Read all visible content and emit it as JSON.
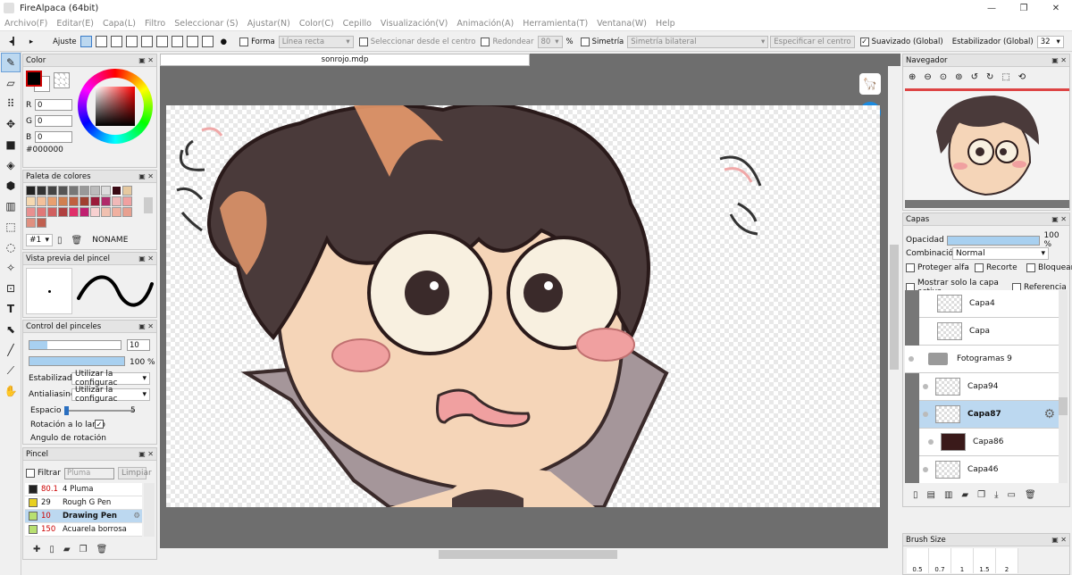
{
  "window": {
    "title": "FireAlpaca (64bit)"
  },
  "menu": [
    "Archivo(F)",
    "Editar(E)",
    "Capa(L)",
    "Filtro",
    "Seleccionar (S)",
    "Ajustar(N)",
    "Color(C)",
    "Cepillo",
    "Visualización(V)",
    "Animación(A)",
    "Herramienta(T)",
    "Ventana(W)",
    "Help"
  ],
  "toolbar": {
    "ajuste": "Ajuste",
    "forma": "Forma",
    "forma_value": "Línea recta",
    "sel_centro": "Seleccionar desde el centro",
    "redondear": "Redondear",
    "redondear_value": "80",
    "percent": "%",
    "simetria": "Simetría",
    "simetria_value": "Simetría bilateral",
    "especificar": "Especificar el centro",
    "suavizado": "Suavizado (Global)",
    "estabilizador": "Estabilizador (Global)",
    "estabilizador_value": "32"
  },
  "color_panel": {
    "title": "Color",
    "r_label": "R",
    "g_label": "G",
    "b_label": "B",
    "r": "0",
    "g": "0",
    "b": "0",
    "hex": "#000000",
    "current": "#000000"
  },
  "palette": {
    "title": "Paleta de colores",
    "slot": "#1",
    "name": "NONAME",
    "colors": [
      "#222222",
      "#333333",
      "#444444",
      "#555555",
      "#777777",
      "#999999",
      "#bbbbbb",
      "#dddddd",
      "#3a0a14",
      "#e6c9a0",
      "#f5d8b0",
      "#f3c09a",
      "#e8a070",
      "#d08050",
      "#c06040",
      "#a04030",
      "#9a1a3a",
      "#b02a6a",
      "#f0b8b8",
      "#f0a0a0",
      "#e89090",
      "#e07878",
      "#d06060",
      "#b04040",
      "#e0306a",
      "#c02070",
      "#f8d0d0",
      "#f0c0b0",
      "#f0b0a0",
      "#e8a090",
      "#e09080",
      "#c06050"
    ]
  },
  "brush_preview": {
    "title": "Vista previa del pincel"
  },
  "brush_control": {
    "title": "Control del pinceles",
    "size": "10",
    "opacity": "100 %",
    "estabilizador": "Estabilizador",
    "estabilizador_value": "Utilizar la configurac",
    "antialiasing": "Antialiasing",
    "antialiasing_value": "Utilizar la configurac",
    "espacio": "Espacio",
    "espacio_value": "5",
    "rotacion": "Rotación a lo largo",
    "angulo": "Ángulo de rotación"
  },
  "pincel": {
    "title": "Pincel",
    "filtrar": "Filtrar",
    "filter_placeholder": "Pluma",
    "limpiar": "Limpiar",
    "items": [
      {
        "color": "#222222",
        "size": "80.1",
        "name": "4 Pluma"
      },
      {
        "color": "#e8d020",
        "size": "29",
        "name": "Rough G Pen"
      },
      {
        "color": "#b8e070",
        "size": "10",
        "name": "Drawing Pen"
      },
      {
        "color": "#b8e070",
        "size": "150",
        "name": "Acuarela borrosa"
      }
    ]
  },
  "document": {
    "tab": "sonrojo.mdp"
  },
  "navigator": {
    "title": "Navegador"
  },
  "layers": {
    "title": "Capas",
    "opacidad": "Opacidad",
    "opacidad_value": "100 %",
    "combinacion": "Combinación",
    "combinacion_value": "Normal",
    "proteger": "Proteger alfa",
    "recorte": "Recorte",
    "bloquear": "Bloquear",
    "mostrar": "Mostrar solo la capa activa",
    "referencia": "Referencia",
    "items": [
      {
        "name": "Capa4"
      },
      {
        "name": "Capa"
      },
      {
        "name": "Fotogramas 9"
      },
      {
        "name": "Capa94"
      },
      {
        "name": "Capa87"
      },
      {
        "name": "Capa86"
      },
      {
        "name": "Capa46"
      }
    ]
  },
  "brush_size": {
    "title": "Brush Size",
    "values": [
      "0.5",
      "0.7",
      "1",
      "1.5",
      "2"
    ]
  }
}
